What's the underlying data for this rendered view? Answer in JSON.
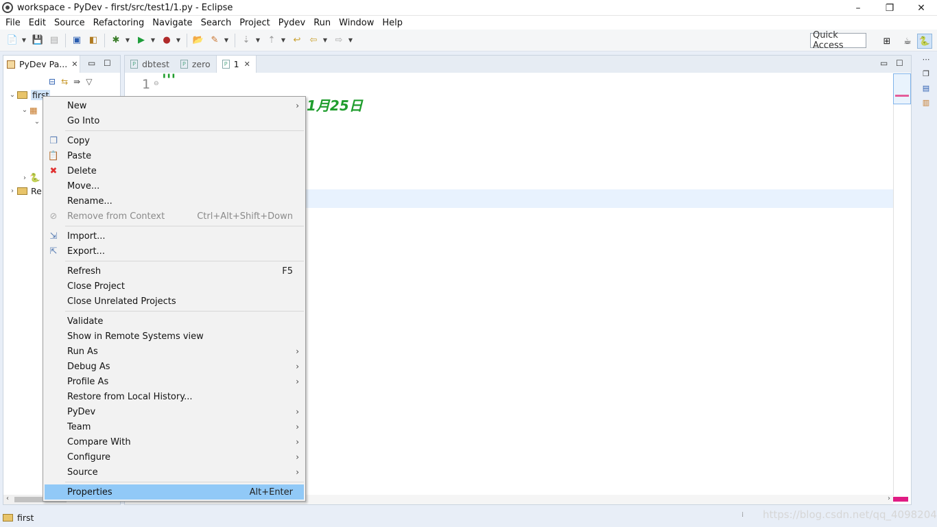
{
  "window": {
    "title": "workspace - PyDev - first/src/test1/1.py - Eclipse",
    "minimize": "–",
    "restore": "❐",
    "close": "✕"
  },
  "menubar": [
    "File",
    "Edit",
    "Source",
    "Refactoring",
    "Navigate",
    "Search",
    "Project",
    "Pydev",
    "Run",
    "Window",
    "Help"
  ],
  "toolbar": {
    "quick_access": "Quick Access"
  },
  "left_panel": {
    "tab_label": "PyDev Pa...",
    "tree": {
      "root": "first",
      "second_root": "Re"
    }
  },
  "editor": {
    "tabs": [
      {
        "label": "dbtest",
        "active": false
      },
      {
        "label": "zero",
        "active": false
      },
      {
        "label": "1",
        "active": true
      }
    ],
    "line_number": "1",
    "code_line1": "'''",
    "code_line2": "1月25日"
  },
  "context_menu": {
    "items": [
      {
        "label": "New",
        "submenu": true
      },
      {
        "label": "Go Into"
      },
      {
        "label": "Copy",
        "icon": "copy-icon"
      },
      {
        "label": "Paste",
        "icon": "paste-icon"
      },
      {
        "label": "Delete",
        "icon": "delete-icon"
      },
      {
        "label": "Move..."
      },
      {
        "label": "Rename..."
      },
      {
        "label": "Remove from Context",
        "shortcut": "Ctrl+Alt+Shift+Down",
        "disabled": true,
        "icon": "remove-context-icon"
      },
      {
        "label": "Import...",
        "icon": "import-icon"
      },
      {
        "label": "Export...",
        "icon": "export-icon"
      },
      {
        "label": "Refresh",
        "shortcut": "F5"
      },
      {
        "label": "Close Project"
      },
      {
        "label": "Close Unrelated Projects"
      },
      {
        "label": "Validate"
      },
      {
        "label": "Show in Remote Systems view"
      },
      {
        "label": "Run As",
        "submenu": true
      },
      {
        "label": "Debug As",
        "submenu": true
      },
      {
        "label": "Profile As",
        "submenu": true
      },
      {
        "label": "Restore from Local History..."
      },
      {
        "label": "PyDev",
        "submenu": true
      },
      {
        "label": "Team",
        "submenu": true
      },
      {
        "label": "Compare With",
        "submenu": true
      },
      {
        "label": "Configure",
        "submenu": true
      },
      {
        "label": "Source",
        "submenu": true
      },
      {
        "label": "Properties",
        "shortcut": "Alt+Enter",
        "highlighted": true
      }
    ]
  },
  "statusbar": {
    "selection": "first",
    "watermark": "https://blog.csdn.net/qq_40982044"
  },
  "colors": {
    "code_green": "#1f9d2d",
    "menu_highlight": "#91c9f7",
    "error_marker": "#e01c84"
  }
}
